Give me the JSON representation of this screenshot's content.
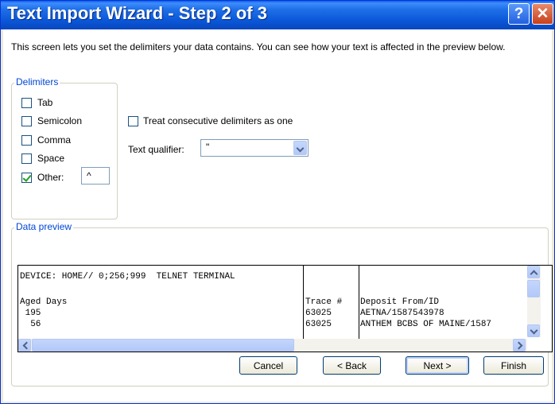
{
  "window": {
    "title": "Text Import Wizard - Step 2 of 3",
    "help_glyph": "?",
    "close_glyph": "✕"
  },
  "description": "This screen lets you set the delimiters your data contains.  You can see how your text is affected in the preview below.",
  "delimiters": {
    "legend": "Delimiters",
    "items": [
      {
        "label": "Tab",
        "checked": false
      },
      {
        "label": "Semicolon",
        "checked": false
      },
      {
        "label": "Comma",
        "checked": false
      },
      {
        "label": "Space",
        "checked": false
      },
      {
        "label": "Other:",
        "checked": true
      }
    ],
    "other_value": "^"
  },
  "options": {
    "consecutive_label": "Treat consecutive delimiters as one",
    "consecutive_checked": false,
    "qualifier_label": "Text qualifier:",
    "qualifier_value": "\""
  },
  "preview": {
    "legend": "Data preview",
    "rows": [
      {
        "c1": "DEVICE: HOME// 0;256;999  TELNET TERMINAL",
        "c2": "",
        "c3": ""
      },
      {
        "c1": "",
        "c2": "",
        "c3": ""
      },
      {
        "c1": "Aged Days",
        "c2": "Trace #",
        "c3": "Deposit From/ID"
      },
      {
        "c1": " 195",
        "c2": "63025",
        "c3": "AETNA/1587543978"
      },
      {
        "c1": "  56",
        "c2": "63025",
        "c3": "ANTHEM BCBS OF MAINE/1587"
      }
    ]
  },
  "buttons": {
    "cancel": "Cancel",
    "back": "< Back",
    "next": "Next >",
    "finish": "Finish"
  },
  "colors": {
    "titlebar": "#0a57d8",
    "legend_text": "#0046d5",
    "checkbox_check": "#21a121"
  }
}
